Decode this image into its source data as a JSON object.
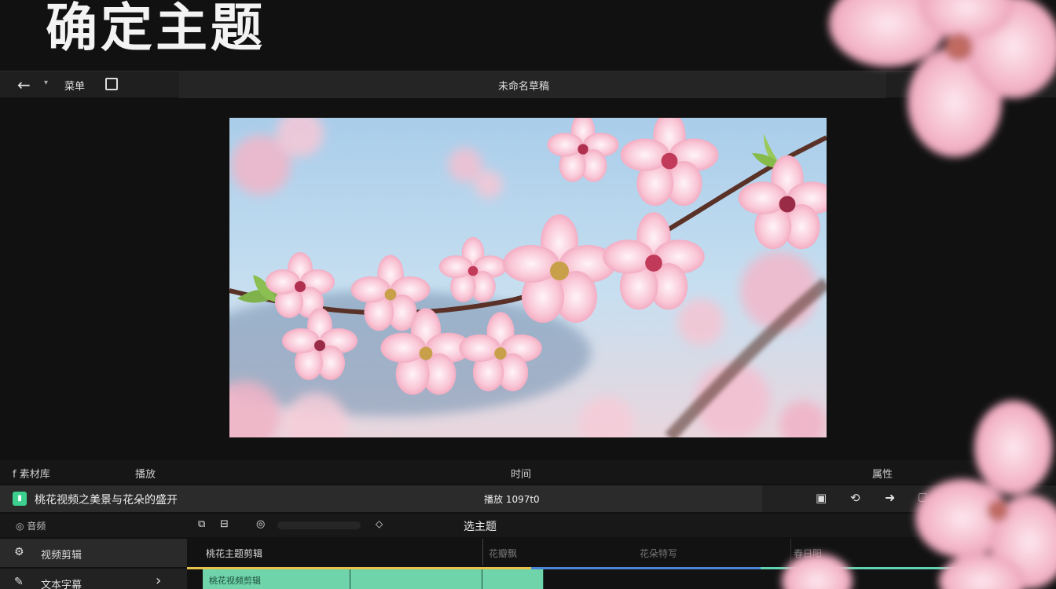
{
  "heading": "确定主题",
  "topbar": {
    "back_menu_label": "菜单",
    "title": "未命名草稿"
  },
  "labels": {
    "col1": "f 素材库",
    "col2": "播放",
    "col3": "时间",
    "col4": "属性"
  },
  "clip_info": {
    "badge": "▮",
    "name": "桃花视频之美景与花朵的盛开",
    "duration": "播放 1097t0"
  },
  "tools": {
    "left_label": "◎ 音频",
    "center_label": "选主题"
  },
  "sidebar": {
    "items": [
      {
        "label": "视频剪辑"
      },
      {
        "label": "文本字幕"
      }
    ]
  },
  "timeline": {
    "segments": [
      "桃花主题剪辑",
      "花瓣飘",
      "花朵特写",
      "春日阳"
    ],
    "clip_label": "桃花视频剪辑"
  },
  "colors": {
    "bg": "#111111",
    "clip": "#6fd4aa",
    "accent_yellow": "#e6c34a",
    "accent_blue": "#4a86d6",
    "accent_teal": "#5fd3b1"
  }
}
